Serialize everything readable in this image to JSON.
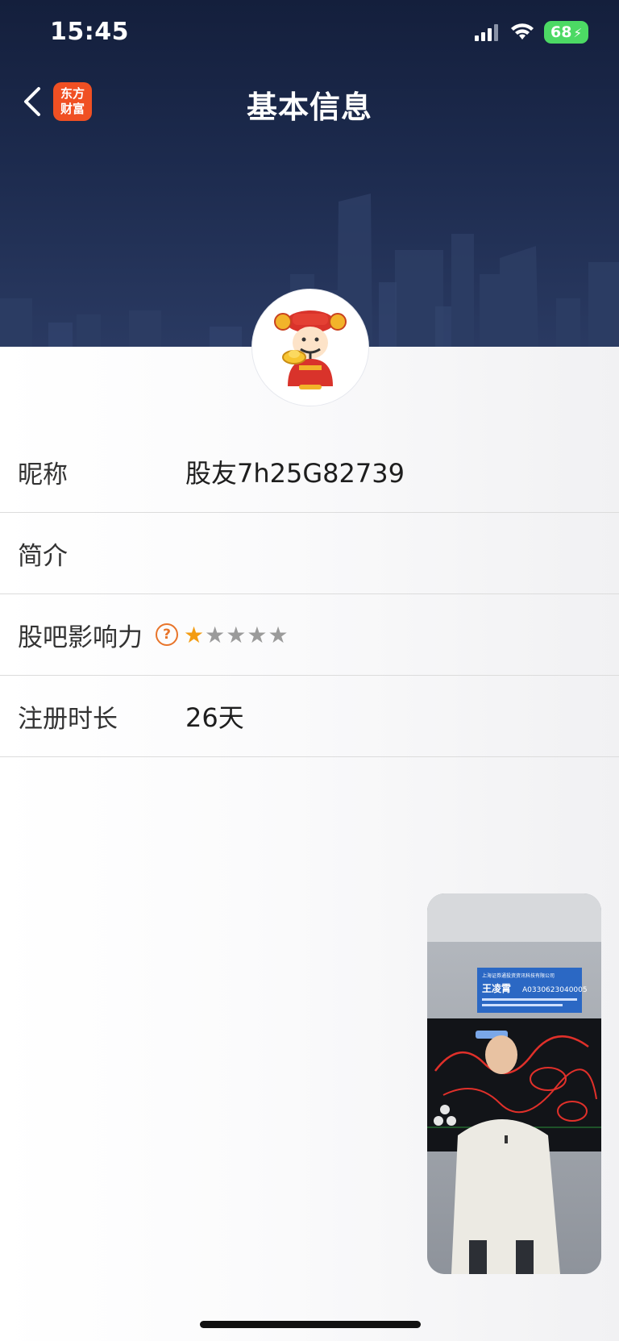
{
  "status_bar": {
    "time": "15:45",
    "battery": "68",
    "icons": [
      "signal-icon",
      "wifi-icon",
      "battery-icon"
    ]
  },
  "nav": {
    "title": "基本信息",
    "logo_line1": "东方",
    "logo_line2": "财富",
    "back_icon": "chevron-left-icon"
  },
  "profile": {
    "rows": [
      {
        "label": "昵称",
        "value": "股友7h25G82739"
      },
      {
        "label": "简介",
        "value": ""
      },
      {
        "label": "股吧影响力",
        "help": "?",
        "stars_filled": 1,
        "stars_total": 5
      },
      {
        "label": "注册时长",
        "value": "26天"
      }
    ]
  },
  "video_overlay": {
    "banner_company": "上海证券通投资资讯科技有限公司",
    "banner_name": "王凌霄",
    "banner_id": "A0330623040005"
  },
  "colors": {
    "header_bg": "#1c2a4d",
    "accent": "#f39c12",
    "logo_bg": "#f05023"
  }
}
